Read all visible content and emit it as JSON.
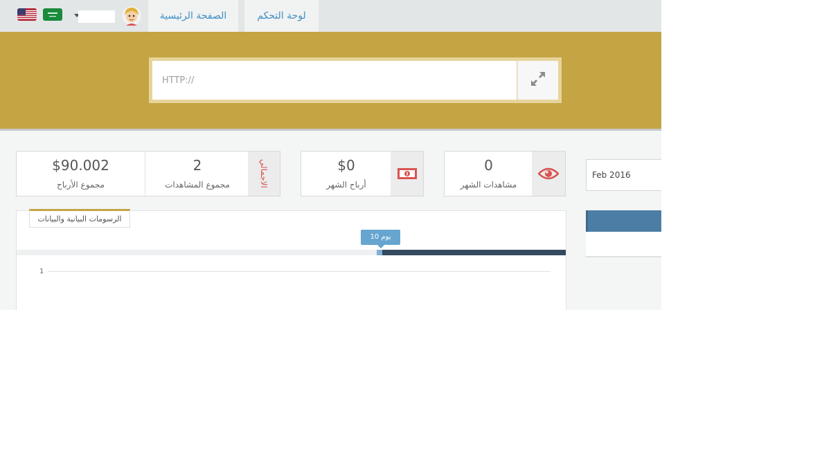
{
  "nav": {
    "dashboard_label": "لوحة التحكم",
    "home_label": "الصفحة الرئيسية",
    "languages": [
      {
        "name": "english",
        "icon": "us-flag-icon"
      },
      {
        "name": "arabic",
        "icon": "sa-flag-icon"
      }
    ],
    "dropdown_icon": "caret-down-icon",
    "avatar_icon": "user-avatar-icon"
  },
  "shortener": {
    "placeholder": "HTTP://",
    "button_icon": "expand-arrows-icon",
    "colors": {
      "band": "#c4a443",
      "frame": "#e7d49a"
    }
  },
  "stats": {
    "monthly_views": {
      "value": "0",
      "label": "مشاهدات الشهر",
      "icon": "eye-icon",
      "icon_color": "#d9534f"
    },
    "monthly_earnings": {
      "value": "$0",
      "label": "أرباح الشهر",
      "icon": "money-bill-icon",
      "icon_color": "#d9534f"
    },
    "total": {
      "side_label": "الاجمالي",
      "views_value": "2",
      "views_label": "مجموع المشاهدات",
      "earnings_value": "$90.002",
      "earnings_label": "مجموع الأرباح"
    }
  },
  "date_filter": {
    "value": "Feb 2016"
  },
  "chart": {
    "tab_label": "الرسومات البيانية والبيانات",
    "slider_label": "10 يوم",
    "y_tick": "1"
  }
}
